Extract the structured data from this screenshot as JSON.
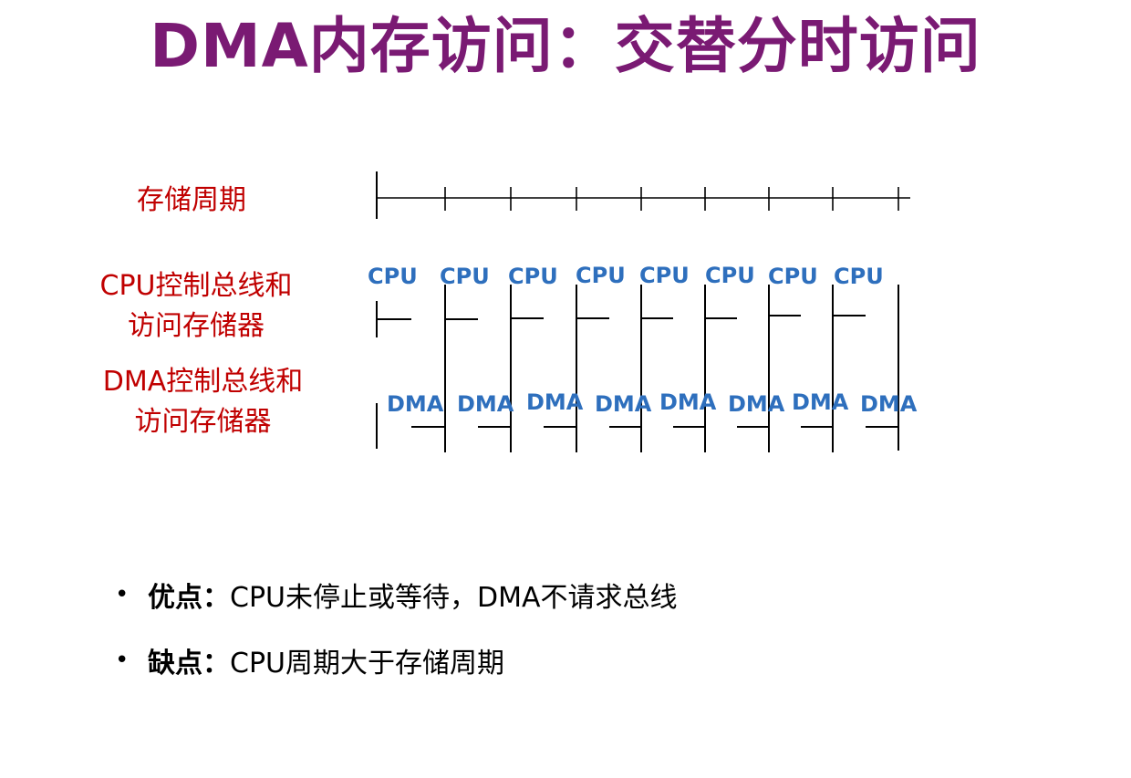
{
  "title": "DMA内存访问：交替分时访问",
  "colors": {
    "title": "#7a1a73",
    "row_label": "#c00000",
    "tag": "#2e6fbd",
    "line": "#000000"
  },
  "diagram": {
    "rows": [
      {
        "id": "memory-cycle",
        "label_lines": [
          "存储周期"
        ]
      },
      {
        "id": "cpu-access",
        "label_lines": [
          "CPU控制总线和",
          "访问存储器"
        ],
        "tag": "CPU",
        "tag_count": 8
      },
      {
        "id": "dma-access",
        "label_lines": [
          "DMA控制总线和",
          "访问存储器"
        ],
        "tag": "DMA",
        "tag_count": 8
      }
    ],
    "memory_cycle_count": 8,
    "cpu_segments": 8,
    "dma_segments": 8
  },
  "bullets": [
    {
      "key": "优点",
      "sep": "：",
      "text": "CPU未停止或等待，DMA不请求总线"
    },
    {
      "key": "缺点",
      "sep": "：",
      "text": "CPU周期大于存储周期"
    }
  ]
}
